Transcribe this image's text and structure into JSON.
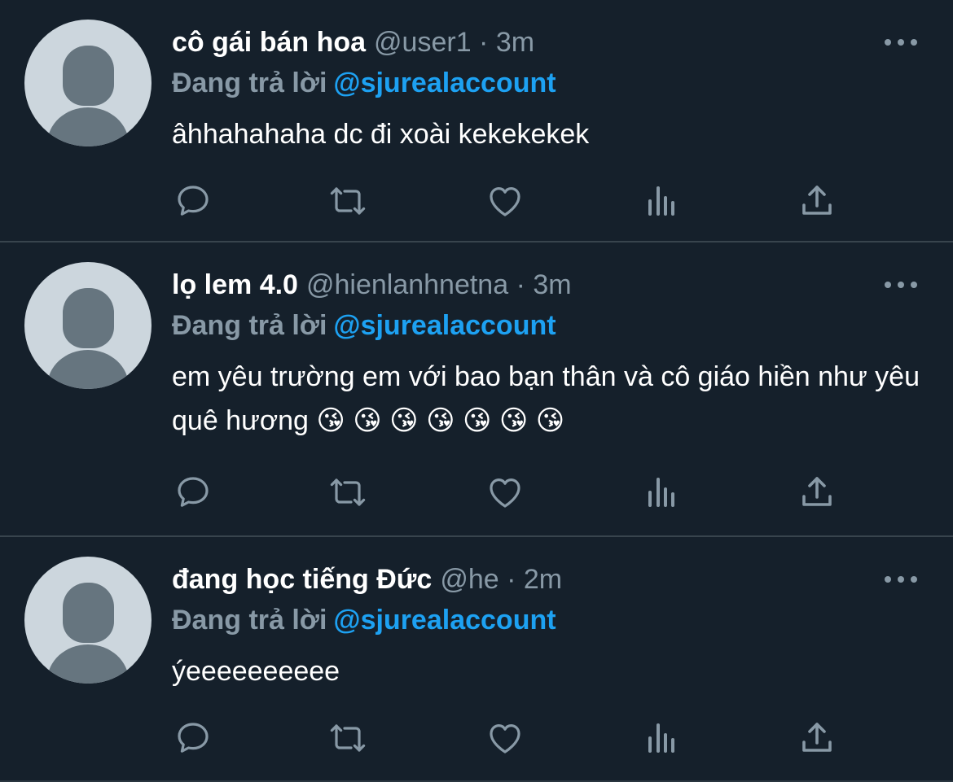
{
  "tweets": [
    {
      "name": "cô gái bán hoa",
      "meta": "@user1 · 3m",
      "reply_label": "Đang trả lời",
      "reply_handle": "@sjurealaccount",
      "text": "âhhahahaha dc đi xoài kekekekek"
    },
    {
      "name": "lọ lem 4.0",
      "meta": "@hienlanhnetna · 3m",
      "reply_label": "Đang trả lời",
      "reply_handle": "@sjurealaccount",
      "text": "em yêu trường em với bao bạn thân và cô giáo hiền như yêu quê hương 😘 😘 😘 😘 😘 😘 😘"
    },
    {
      "name": "đang học tiếng Đức",
      "meta": "@he · 2m",
      "reply_label": "Đang trả lời",
      "reply_handle": "@sjurealaccount",
      "text": "ýeeeeeeeeee"
    }
  ],
  "icons": {
    "more": "more-dots-icon",
    "reply": "comment-icon",
    "retweet": "retweet-icon",
    "like": "heart-icon",
    "analytics": "analytics-icon",
    "share": "share-icon"
  },
  "colors": {
    "background": "#15202b",
    "divider": "#38444d",
    "secondary_text": "#8899a6",
    "accent": "#1da1f2",
    "avatar_bg": "#ccd6dd",
    "avatar_fg": "#66757f"
  }
}
